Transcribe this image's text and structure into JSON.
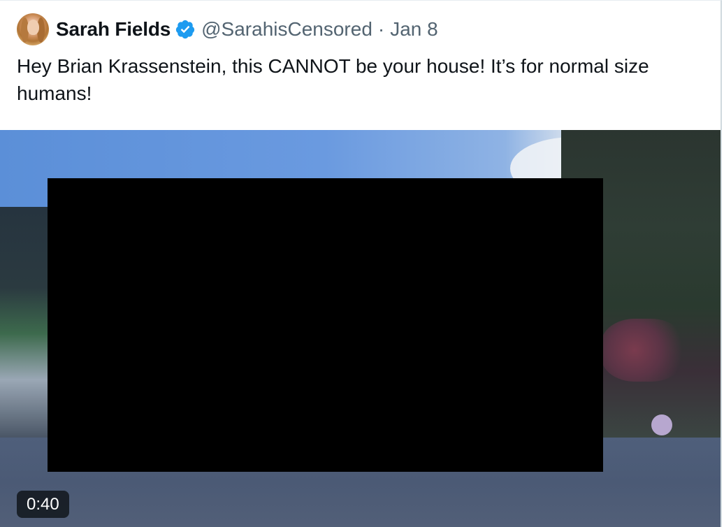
{
  "tweet": {
    "author": {
      "display_name": "Sarah Fields",
      "handle": "@SarahisCensored",
      "verified": true,
      "verified_color": "#1d9bf0",
      "avatar_icon": "avatar"
    },
    "separator": "·",
    "date": "Jan 8",
    "text": "Hey Brian Krassenstein, this CANNOT be your house! It’s for normal size humans!",
    "media": {
      "type": "video",
      "duration": "0:40",
      "redacted": true
    }
  },
  "colors": {
    "text_primary": "#0f1419",
    "text_secondary": "#536471",
    "redaction": "#000000"
  }
}
